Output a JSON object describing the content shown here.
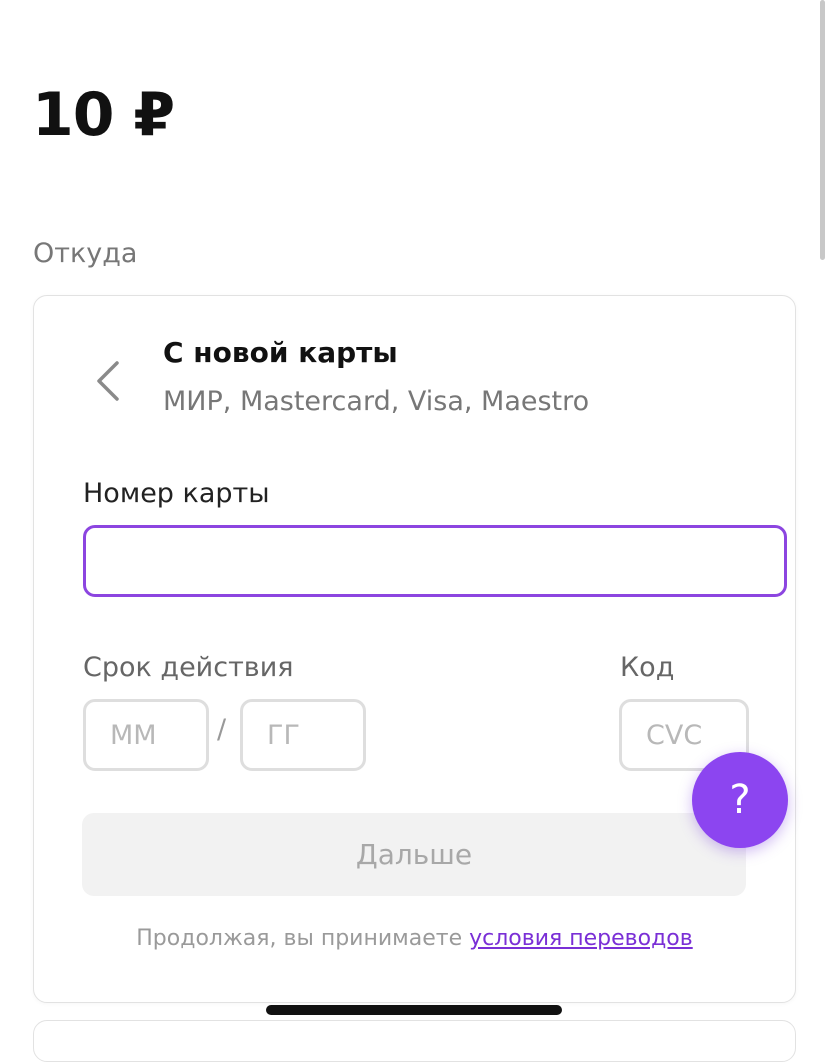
{
  "amount": "10 ₽",
  "from_label": "Откуда",
  "card": {
    "title": "С новой карты",
    "subtitle": "МИР, Mastercard, Visa, Maestro",
    "card_number": {
      "label": "Номер карты",
      "value": "",
      "placeholder": ""
    },
    "expiry": {
      "label": "Срок действия",
      "month_placeholder": "ММ",
      "separator": "/",
      "year_placeholder": "ГГ"
    },
    "cvc": {
      "label": "Код",
      "placeholder": "CVC"
    },
    "next_button": "Дальше",
    "terms": {
      "text": "Продолжая, вы принимаете",
      "link": "условия переводов"
    }
  },
  "help_button": "?",
  "icons": {
    "back": "chevron-left-icon"
  },
  "colors": {
    "accent": "#8c45e0",
    "help": "#8c45f0",
    "link": "#7a2fd6"
  }
}
